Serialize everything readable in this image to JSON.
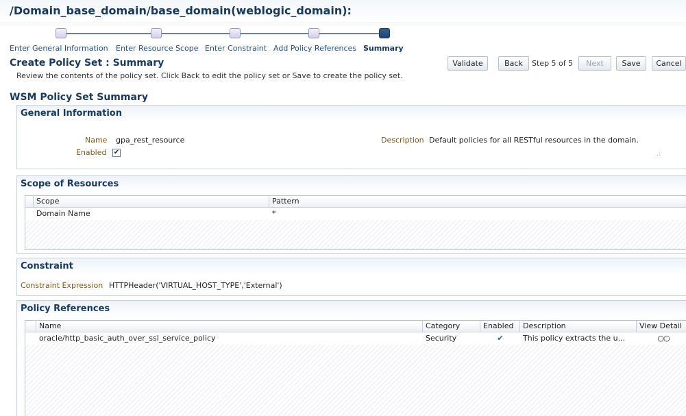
{
  "header": {
    "title": "/Domain_base_domain/base_domain(weblogic_domain):"
  },
  "train": {
    "steps": [
      {
        "label": "Enter General Information"
      },
      {
        "label": "Enter Resource Scope"
      },
      {
        "label": "Enter Constraint"
      },
      {
        "label": "Add Policy References"
      },
      {
        "label": "Summary"
      }
    ]
  },
  "page": {
    "title": "Create Policy Set : Summary",
    "subtitle": "Review the contents of the policy set. Click Back to edit the policy set or Save to create the policy set."
  },
  "toolbar": {
    "validate": "Validate",
    "back": "Back",
    "step_text": "Step 5 of 5",
    "next": "Next",
    "save": "Save",
    "cancel": "Cancel"
  },
  "summary": {
    "title": "WSM Policy Set Summary",
    "general": {
      "title": "General Information",
      "name_label": "Name",
      "name_value": "gpa_rest_resource",
      "enabled_label": "Enabled",
      "enabled_checked": true,
      "description_label": "Description",
      "description_value": "Default policies for all RESTful resources in the domain."
    },
    "scope": {
      "title": "Scope of Resources",
      "columns": [
        "Scope",
        "Pattern"
      ],
      "rows": [
        {
          "scope": "Domain Name",
          "pattern": "*"
        }
      ]
    },
    "constraint": {
      "title": "Constraint",
      "label": "Constraint Expression",
      "value": "HTTPHeader('VIRTUAL_HOST_TYPE','External')"
    },
    "policies": {
      "title": "Policy References",
      "columns": [
        "Name",
        "Category",
        "Enabled",
        "Description",
        "View Detail"
      ],
      "rows": [
        {
          "name": "oracle/http_basic_auth_over_ssl_service_policy",
          "category": "Security",
          "enabled": "✔",
          "description": "This policy extracts the u...",
          "view_icon": "glasses-icon"
        }
      ]
    }
  }
}
